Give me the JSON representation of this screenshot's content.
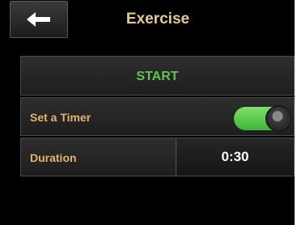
{
  "header": {
    "title": "Exercise",
    "back_icon": "arrow-left-icon"
  },
  "main": {
    "start_label": "START",
    "timer": {
      "label": "Set a Timer",
      "enabled": true
    },
    "duration": {
      "label": "Duration",
      "value": "0:30"
    }
  },
  "colors": {
    "title": "#e6c98f",
    "start": "#5ec64e",
    "labels": "#e3b46c",
    "toggle_on": "#5ccf4a"
  }
}
